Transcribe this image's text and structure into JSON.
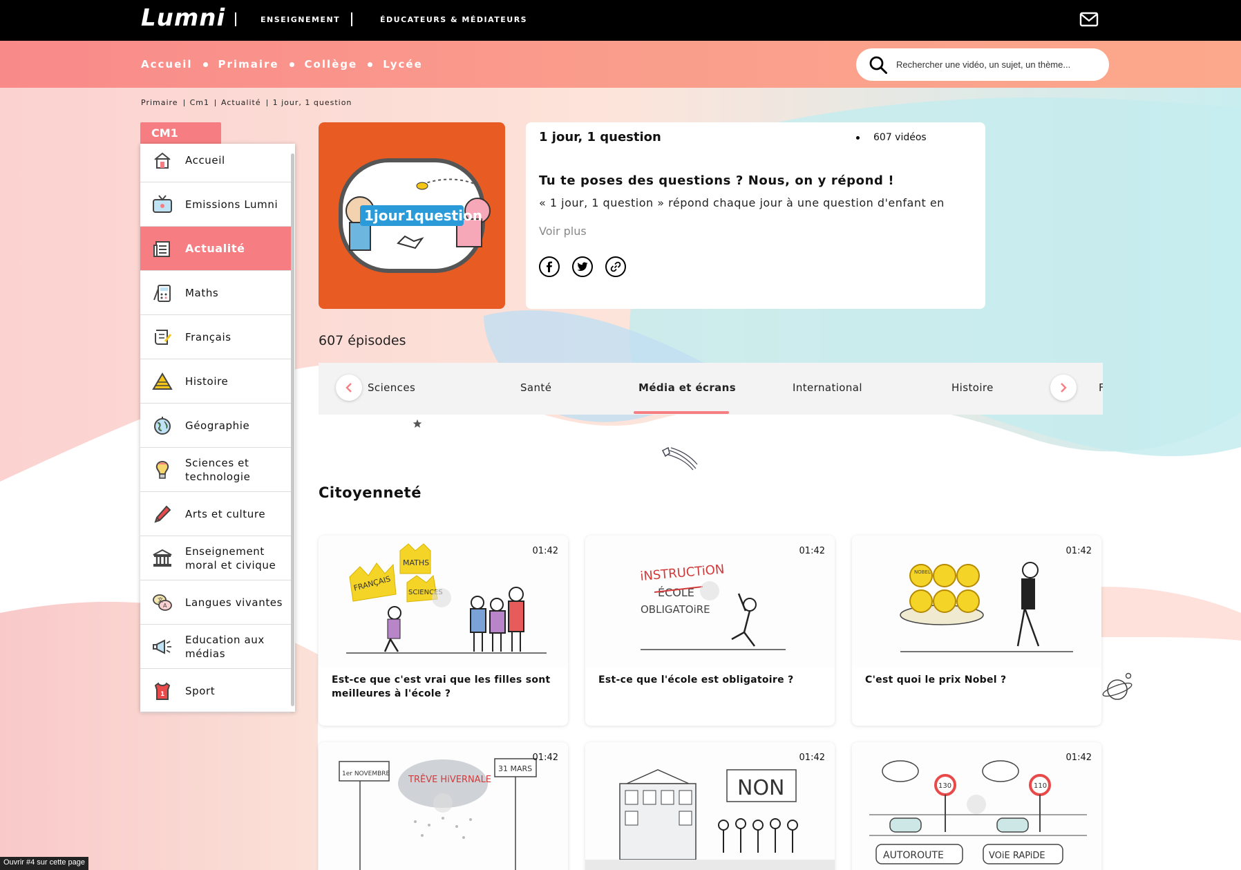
{
  "header": {
    "logo": "Lumni",
    "nav": [
      "ENSEIGNEMENT",
      "ÉDUCATEURS & MÉDIATEURS"
    ],
    "mail_icon": "mail-icon"
  },
  "levels": [
    "Accueil",
    "Primaire",
    "Collège",
    "Lycée"
  ],
  "search": {
    "placeholder": "Rechercher une vidéo, un sujet, un thème..."
  },
  "breadcrumb": [
    "Primaire",
    "Cm1",
    "Actualité",
    "1 jour, 1 question"
  ],
  "sidebar": {
    "level_tab": "CM1",
    "items": [
      {
        "label": "Accueil",
        "icon": "house-icon"
      },
      {
        "label": "Emissions Lumni",
        "icon": "tv-icon"
      },
      {
        "label": "Actualité",
        "icon": "newspaper-icon",
        "active": true
      },
      {
        "label": "Maths",
        "icon": "calculator-icon"
      },
      {
        "label": "Français",
        "icon": "scroll-icon"
      },
      {
        "label": "Histoire",
        "icon": "pyramid-icon"
      },
      {
        "label": "Géographie",
        "icon": "globe-icon"
      },
      {
        "label": "Sciences et technologie",
        "icon": "lightbulb-icon"
      },
      {
        "label": "Arts et culture",
        "icon": "pencil-icon"
      },
      {
        "label": "Enseignement moral et civique",
        "icon": "institution-icon"
      },
      {
        "label": "Langues vivantes",
        "icon": "speech-bubbles-icon"
      },
      {
        "label": "Education aux médias",
        "icon": "megaphone-icon"
      },
      {
        "label": "Sport",
        "icon": "jersey-icon"
      }
    ]
  },
  "show": {
    "cover_text": "1jour1question",
    "title": "1 jour, 1 question",
    "video_count": "607 vidéos",
    "tagline": "Tu te poses des questions ? Nous, on y répond !",
    "description": "« 1 jour, 1 question » répond chaque jour à une question d'enfant en",
    "more": "Voir plus",
    "socials": [
      "facebook-icon",
      "twitter-icon",
      "link-icon"
    ]
  },
  "episodes_label": "607 épisodes",
  "categories": {
    "items": [
      "Sciences",
      "Santé",
      "Média et écrans",
      "International",
      "Histoire",
      "F"
    ],
    "active": "Média et écrans"
  },
  "section": {
    "title": "Citoyenneté",
    "videos": [
      {
        "duration": "01:42",
        "title": "Est-ce que c'est vrai que les filles sont meilleures à l'école ?",
        "thumb_words": [
          "FRANÇAIS",
          "MATHS",
          "SCIENCES"
        ]
      },
      {
        "duration": "01:42",
        "title": "Est-ce que l'école est obligatoire ?",
        "thumb_words": [
          "iNSTRUCTiON",
          "ÉCOLE",
          "OBLIGATOiRE"
        ]
      },
      {
        "duration": "01:42",
        "title": "C'est quoi le prix Nobel ?",
        "thumb_words": [
          "NOBEL"
        ]
      },
      {
        "duration": "01:42",
        "title": "",
        "thumb_words": [
          "1er NOVEMBRE",
          "31 MARS",
          "TRÊVE HiVERNALE"
        ]
      },
      {
        "duration": "01:42",
        "title": "",
        "thumb_words": [
          "NON"
        ]
      },
      {
        "duration": "01:42",
        "title": "",
        "thumb_words": [
          "130",
          "110",
          "AUTOROUTE",
          "VOiE RAPiDE"
        ]
      }
    ]
  },
  "status_tip": "Ouvrir #4 sur cette page",
  "colors": {
    "accent": "#f67e82",
    "cover": "#e85b22",
    "nav_gradient_start": "#f98a8a",
    "nav_gradient_end": "#fca88c"
  }
}
